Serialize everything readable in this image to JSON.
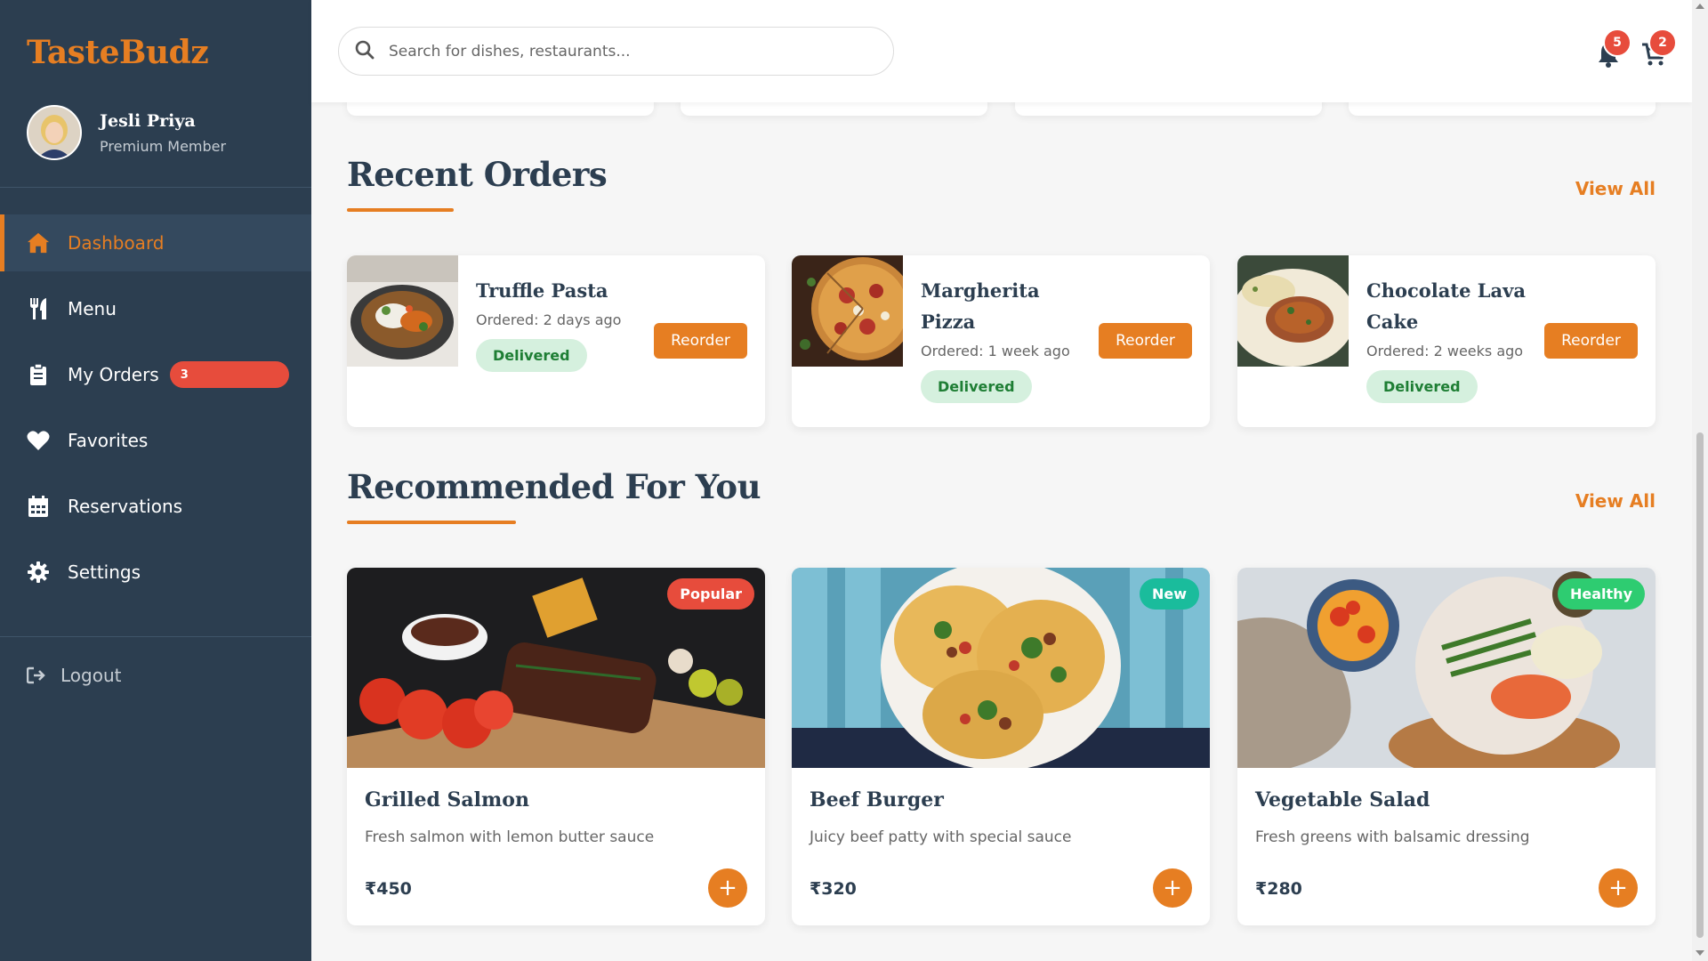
{
  "brand": "TasteBudz",
  "profile": {
    "name": "Jesli Priya",
    "role": "Premium Member"
  },
  "nav": [
    {
      "label": "Dashboard",
      "icon": "home-icon",
      "active": true
    },
    {
      "label": "Menu",
      "icon": "utensils-icon"
    },
    {
      "label": "My Orders",
      "icon": "clipboard-icon",
      "badge": "3"
    },
    {
      "label": "Favorites",
      "icon": "heart-icon"
    },
    {
      "label": "Reservations",
      "icon": "calendar-icon"
    },
    {
      "label": "Settings",
      "icon": "gear-icon"
    }
  ],
  "logout": "Logout",
  "search": {
    "placeholder": "Search for dishes, restaurants...",
    "value": ""
  },
  "header": {
    "notifications_count": "5",
    "cart_count": "2"
  },
  "recent_orders": {
    "title": "Recent Orders",
    "view_all": "View All",
    "items": [
      {
        "name": "Truffle Pasta",
        "ordered": "Ordered: 2 days ago",
        "status": "Delivered",
        "action": "Reorder"
      },
      {
        "name": "Margherita Pizza",
        "ordered": "Ordered: 1 week ago",
        "status": "Delivered",
        "action": "Reorder"
      },
      {
        "name": "Chocolate Lava Cake",
        "ordered": "Ordered: 2 weeks ago",
        "status": "Delivered",
        "action": "Reorder"
      }
    ]
  },
  "recommended": {
    "title": "Recommended For You",
    "view_all": "View All",
    "items": [
      {
        "name": "Grilled Salmon",
        "description": "Fresh salmon with lemon butter sauce",
        "price": "₹450",
        "tag": "Popular",
        "tag_color": "#e74c3c"
      },
      {
        "name": "Beef Burger",
        "description": "Juicy beef patty with special sauce",
        "price": "₹320",
        "tag": "New",
        "tag_color": "#1abc9c"
      },
      {
        "name": "Vegetable Salad",
        "description": "Fresh greens with balsamic dressing",
        "price": "₹280",
        "tag": "Healthy",
        "tag_color": "#2ecc71"
      }
    ],
    "add_label": "+"
  },
  "colors": {
    "accent": "#e67e22",
    "sidebar": "#2c3e50",
    "badge": "#e74c3c",
    "delivered_bg": "#d5f0de"
  }
}
